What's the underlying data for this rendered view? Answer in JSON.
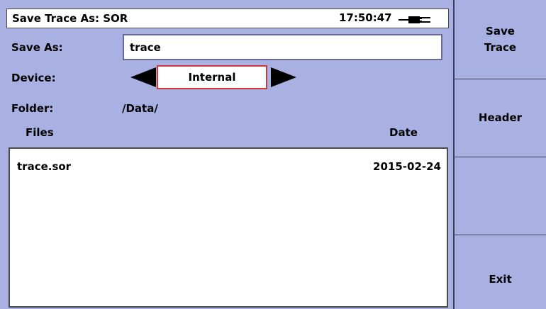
{
  "title_bar": {
    "title": "Save Trace As: SOR",
    "time": "17:50:47",
    "power_icon": "ac-power-plug-icon"
  },
  "form": {
    "save_as_label": "Save As:",
    "save_as_value": "trace",
    "device_label": "Device:",
    "device_value": "Internal",
    "folder_label": "Folder:",
    "folder_value": "/Data/"
  },
  "files": {
    "col_files": "Files",
    "col_date": "Date",
    "rows": [
      {
        "name": "trace.sor",
        "date": "2015-02-24"
      }
    ]
  },
  "softkeys": {
    "save_trace_line1": "Save",
    "save_trace_line2": "Trace",
    "header": "Header",
    "blank": "",
    "exit": "Exit"
  },
  "colors": {
    "background": "#a9b1e3",
    "device_border": "#cf3a3a",
    "field": "#ffffff"
  }
}
